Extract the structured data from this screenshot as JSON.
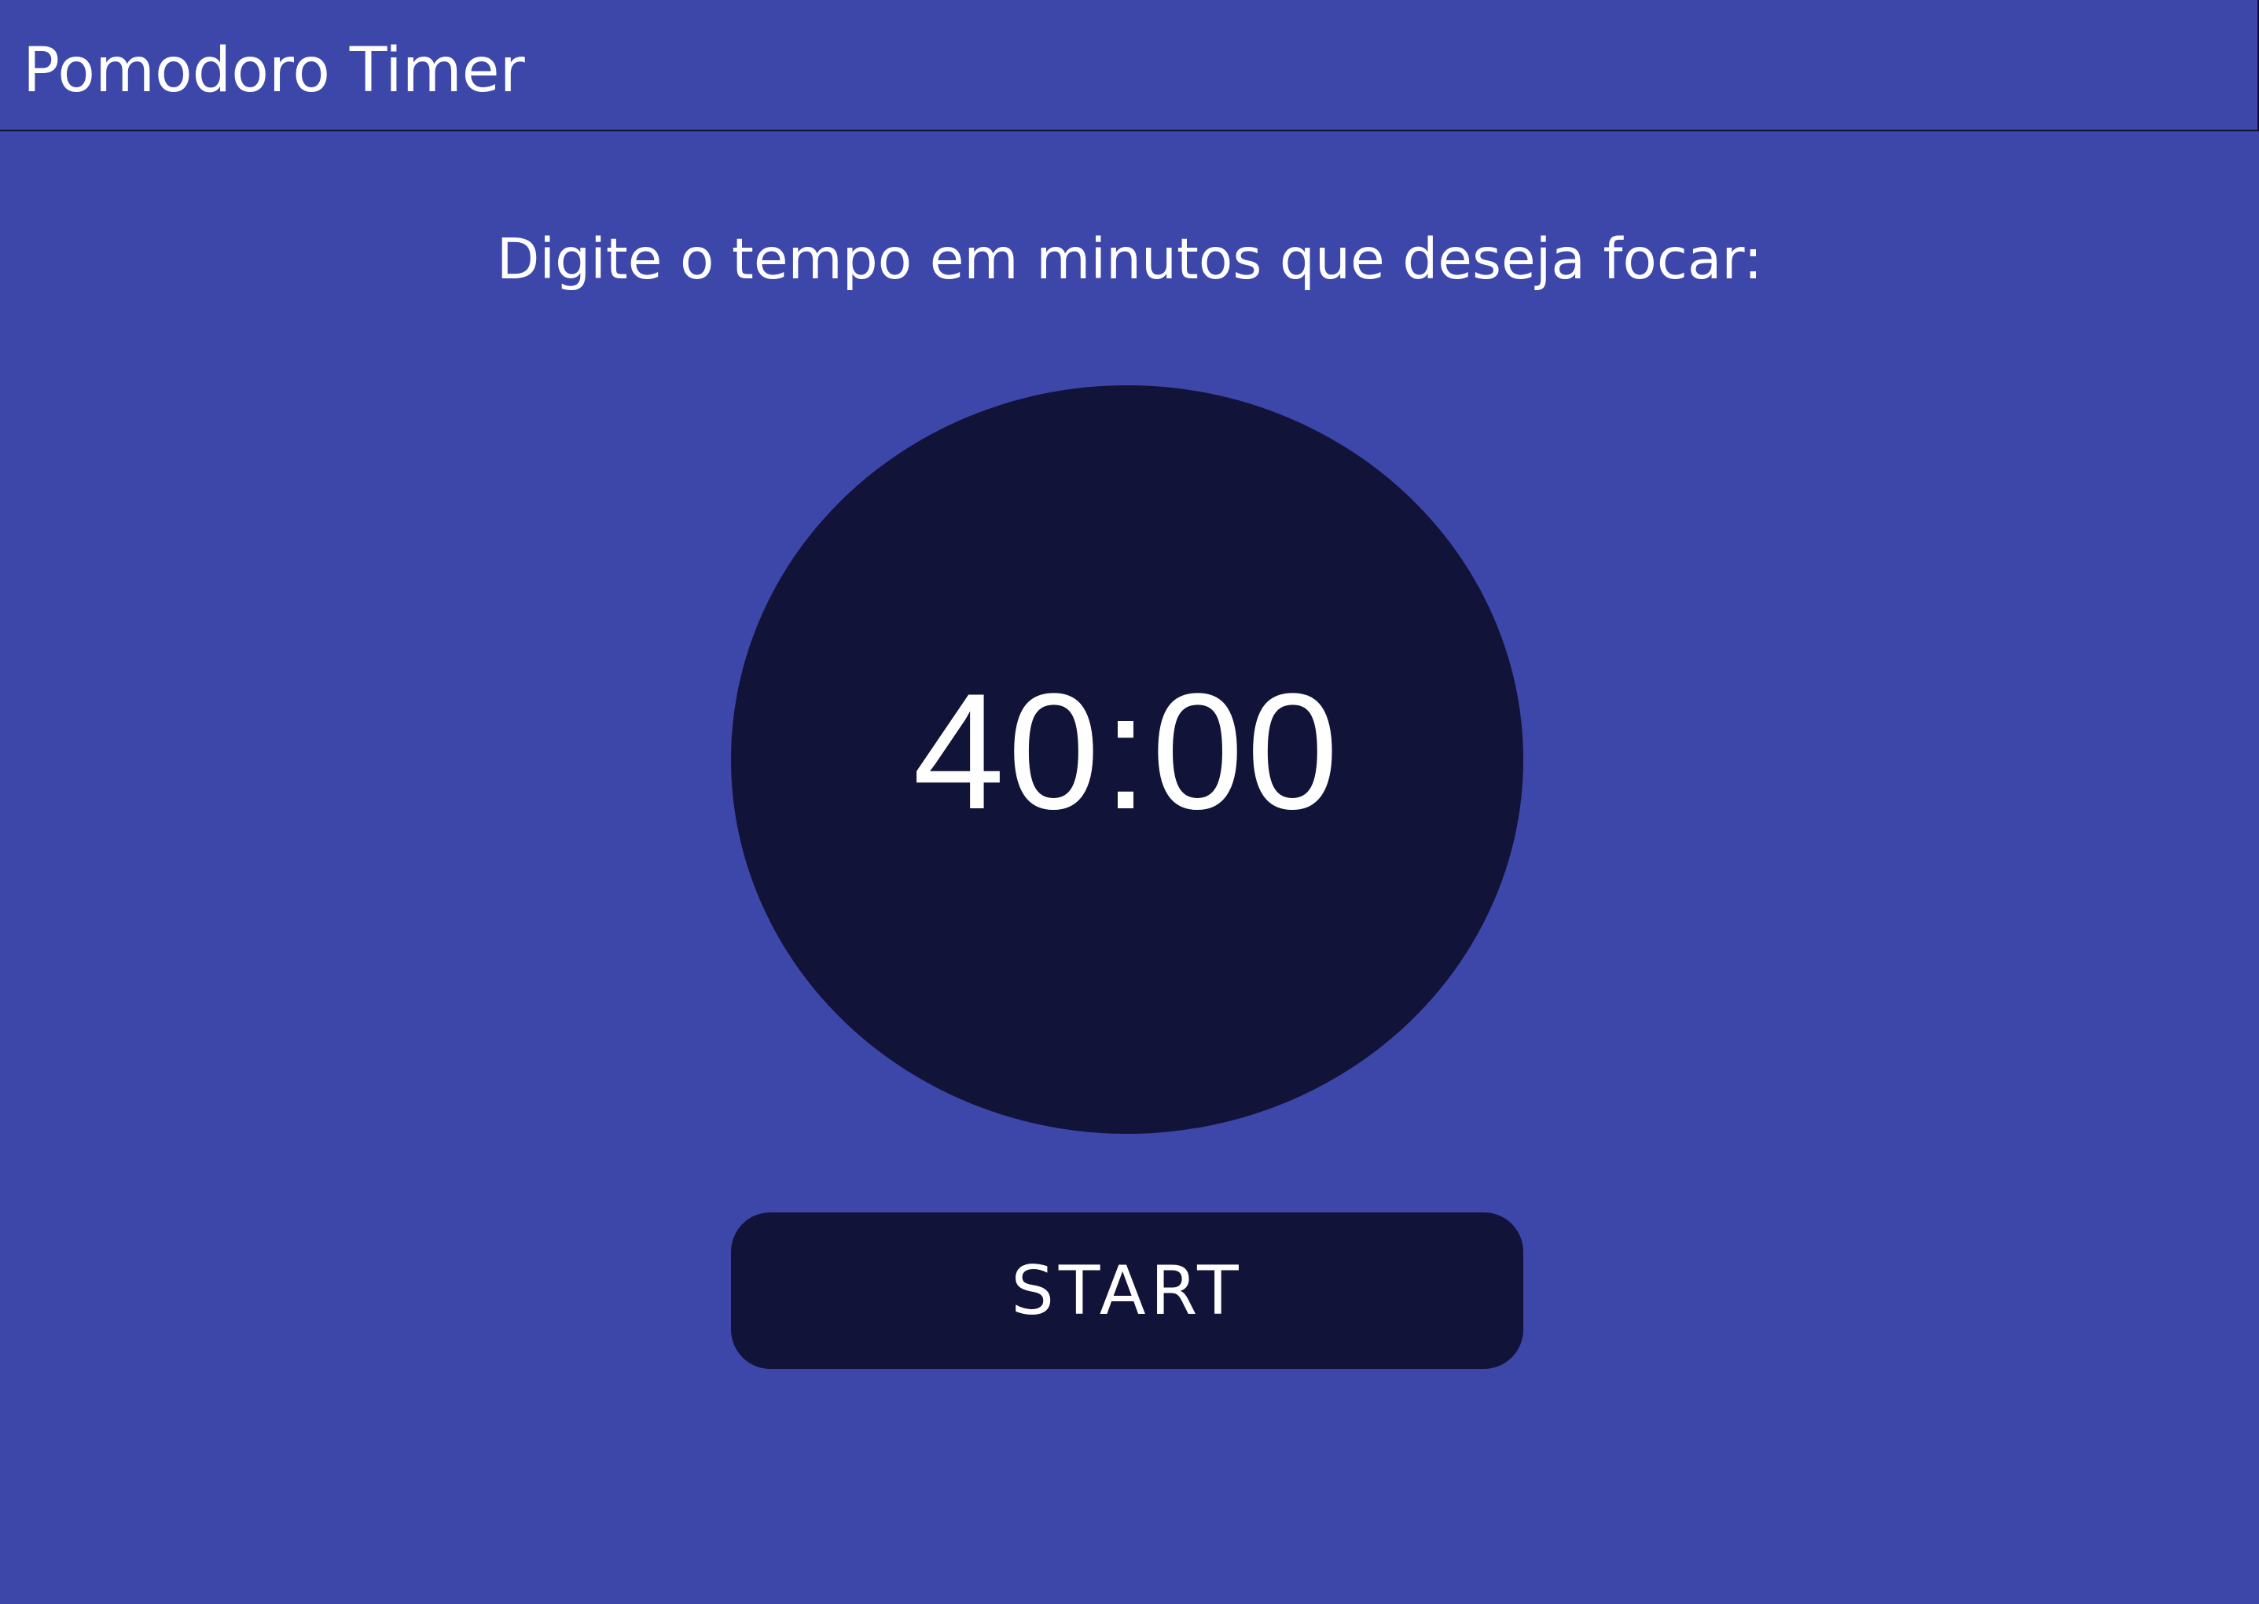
{
  "header": {
    "title": "Pomodoro Timer"
  },
  "main": {
    "prompt": "Digite o tempo em minutos que deseja focar:",
    "timer": {
      "display": "40:00"
    },
    "start_button": {
      "label": "START"
    }
  },
  "colors": {
    "background": "#3c47a9",
    "panel": "#111338",
    "text": "#ffffff"
  }
}
